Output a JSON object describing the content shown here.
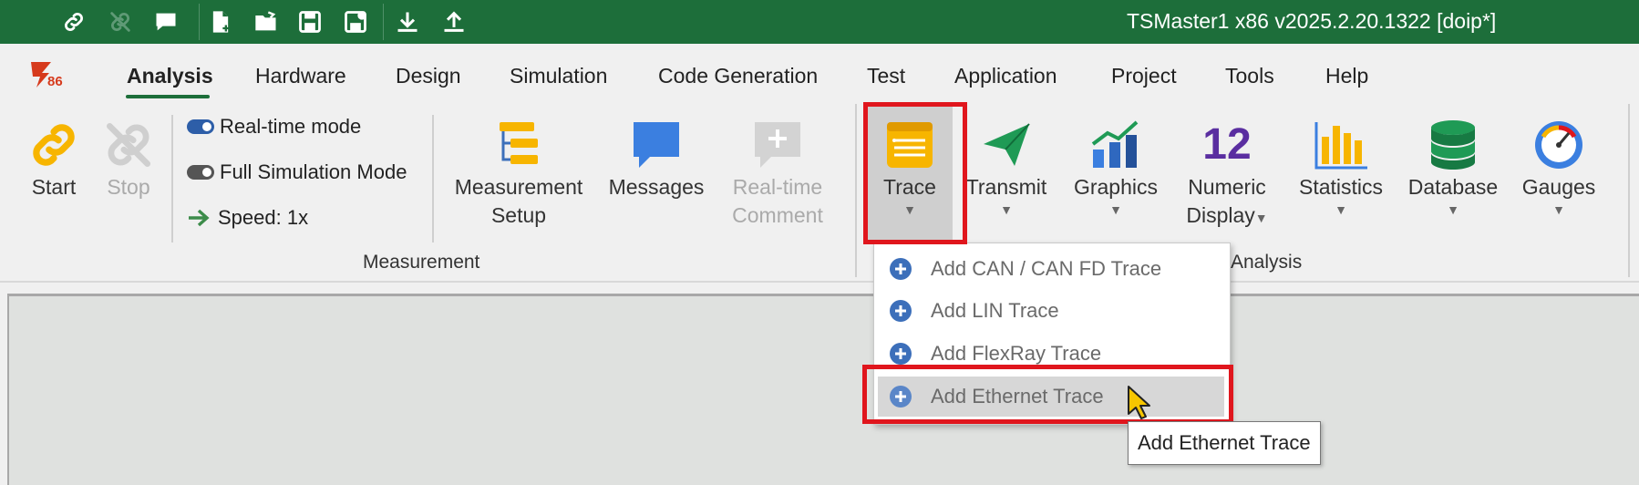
{
  "window": {
    "title": "TSMaster1 x86 v2025.2.20.1322 [doip*]"
  },
  "quick_access": [
    {
      "icon": "link-icon"
    },
    {
      "icon": "unlink-icon"
    },
    {
      "icon": "comment-icon"
    },
    {
      "icon": "new-file-icon"
    },
    {
      "icon": "open-folder-icon"
    },
    {
      "icon": "save-icon"
    },
    {
      "icon": "save-as-icon"
    },
    {
      "icon": "download-icon"
    },
    {
      "icon": "upload-icon"
    }
  ],
  "menu": {
    "logo_text": "86",
    "items": [
      "Analysis",
      "Hardware",
      "Design",
      "Simulation",
      "Code Generation",
      "Test",
      "Application",
      "Project",
      "Tools",
      "Help"
    ],
    "active": "Analysis"
  },
  "ribbon": {
    "start_label": "Start",
    "stop_label": "Stop",
    "realtime_mode_label": "Real-time mode",
    "full_sim_label": "Full Simulation Mode",
    "speed_label": "Speed: 1x",
    "measurement_setup_line1": "Measurement",
    "measurement_setup_line2": "Setup",
    "messages_label": "Messages",
    "realtime_comment_line1": "Real-time",
    "realtime_comment_line2": "Comment",
    "measurement_group_label": "Measurement",
    "trace_label": "Trace",
    "transmit_label": "Transmit",
    "graphics_label": "Graphics",
    "numeric_line1": "Numeric",
    "numeric_line2": "Display",
    "numeric_icon_text": "12",
    "statistics_label": "Statistics",
    "database_label": "Database",
    "gauges_label": "Gauges",
    "analysis_group_label": "Analysis"
  },
  "dropdown": {
    "items": [
      {
        "label": "Add CAN / CAN FD Trace"
      },
      {
        "label": "Add LIN Trace"
      },
      {
        "label": "Add FlexRay Trace"
      },
      {
        "label": "Add Ethernet Trace"
      }
    ],
    "hovered": "Add Ethernet Trace"
  },
  "tooltip": {
    "text": "Add Ethernet Trace"
  },
  "colors": {
    "title_bar": "#1d6e3a",
    "highlight": "#e0161d",
    "accent_blue": "#2d5ea8"
  }
}
